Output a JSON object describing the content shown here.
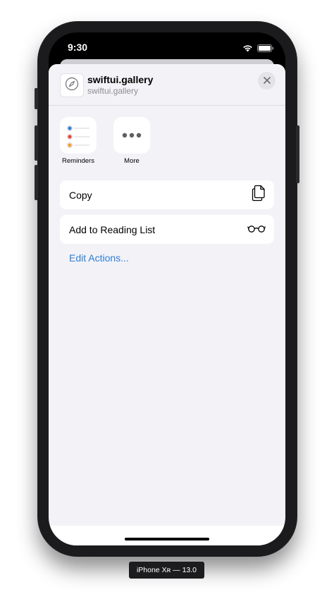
{
  "status_bar": {
    "time": "9:30"
  },
  "share_sheet": {
    "title": "swiftui.gallery",
    "url": "swiftui.gallery",
    "apps": [
      {
        "label": "Reminders",
        "icon": "reminders-icon"
      },
      {
        "label": "More",
        "icon": "more-icon"
      }
    ],
    "actions": [
      {
        "label": "Copy",
        "icon": "copy-icon"
      },
      {
        "label": "Add to Reading List",
        "icon": "glasses-icon"
      }
    ],
    "edit_actions_label": "Edit Actions..."
  },
  "simulator": {
    "device_label": "iPhone Xʀ — 13.0"
  },
  "colors": {
    "accent": "#2f7fd5",
    "sheet_bg": "#f2f2f7",
    "device_frame": "#1b1b1d"
  }
}
